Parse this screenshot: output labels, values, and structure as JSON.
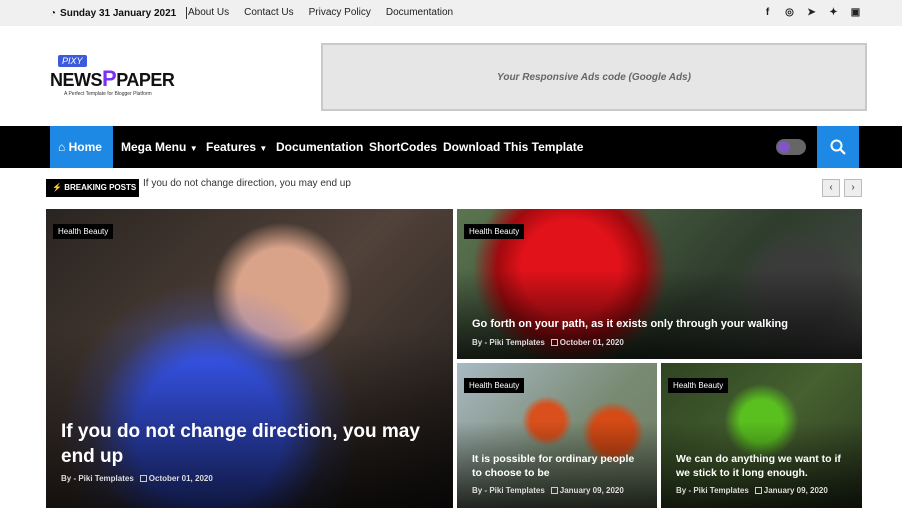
{
  "topbar": {
    "date": "Sunday 31 January 2021",
    "links": [
      "About Us",
      "Contact Us",
      "Privacy Policy",
      "Documentation"
    ],
    "social_icons": [
      "facebook-icon",
      "whatsapp-icon",
      "telegram-icon",
      "twitter-icon",
      "instagram-icon"
    ]
  },
  "logo": {
    "pixy": "PIXY",
    "news": "NEWS",
    "p": "P",
    "paper": "PAPER",
    "tagline": "A Perfect Template for Blogger Platform"
  },
  "ad": {
    "text": "Your Responsive Ads code (Google Ads)"
  },
  "nav": {
    "items": [
      "Home",
      "Mega Menu",
      "Features",
      "Documentation",
      "ShortCodes",
      "Download This Template"
    ],
    "accent": "#1e88e5"
  },
  "breaking": {
    "label": "BREAKING POSTS",
    "text": "If you do not change direction, you may end up"
  },
  "posts": [
    {
      "label": "Health Beauty",
      "title": "If you do not change direction, you may end up",
      "author": "By - Piki Templates",
      "date": "October 01, 2020"
    },
    {
      "label": "Health Beauty",
      "title": "Go forth on your path, as it exists only through your walking",
      "author": "By - Piki Templates",
      "date": "October 01, 2020"
    },
    {
      "label": "Health Beauty",
      "title": "It is possible for ordinary people to choose to be",
      "author": "By - Piki Templates",
      "date": "January 09, 2020"
    },
    {
      "label": "Health Beauty",
      "title": "We can do anything we want to if we stick to it long enough.",
      "author": "By - Piki Templates",
      "date": "January 09, 2020"
    }
  ]
}
